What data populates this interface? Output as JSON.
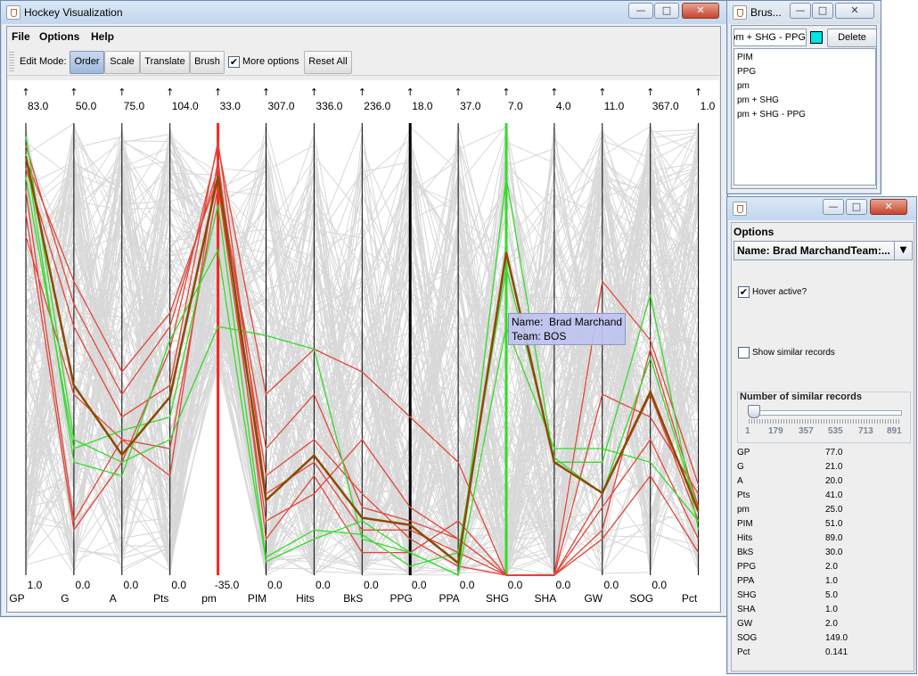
{
  "main_window": {
    "title": "Hockey Visualization",
    "menus": [
      "File",
      "Options",
      "Help"
    ],
    "toolbar": {
      "edit_mode_label": "Edit Mode:",
      "buttons": [
        "Order",
        "Scale",
        "Translate",
        "Brush"
      ],
      "active_button": "Order",
      "more_options_label": "More options",
      "more_options_checked": true,
      "reset_label": "Reset All"
    }
  },
  "chart_data": {
    "type": "parallel-coordinates",
    "axes": [
      {
        "name": "GP",
        "max": "83.0",
        "min": "1.0"
      },
      {
        "name": "G",
        "max": "50.0",
        "min": "0.0"
      },
      {
        "name": "A",
        "max": "75.0",
        "min": "0.0"
      },
      {
        "name": "Pts",
        "max": "104.0",
        "min": "0.0"
      },
      {
        "name": "pm",
        "max": "33.0",
        "min": "-35.0"
      },
      {
        "name": "PIM",
        "max": "307.0",
        "min": "0.0"
      },
      {
        "name": "Hits",
        "max": "336.0",
        "min": "0.0"
      },
      {
        "name": "BkS",
        "max": "236.0",
        "min": "0.0"
      },
      {
        "name": "PPG",
        "max": "18.0",
        "min": "0.0"
      },
      {
        "name": "PPA",
        "max": "37.0",
        "min": "0.0"
      },
      {
        "name": "SHG",
        "max": "7.0",
        "min": "0.0"
      },
      {
        "name": "SHA",
        "max": "4.0",
        "min": "0.0"
      },
      {
        "name": "GW",
        "max": "11.0",
        "min": "0.0"
      },
      {
        "name": "SOG",
        "max": "367.0",
        "min": "0.0"
      },
      {
        "name": "Pct",
        "max": "1.0",
        "min": ""
      }
    ],
    "highlight": {
      "name": "Brad Marchand",
      "values": [
        77.0,
        21.0,
        20.0,
        41.0,
        25.0,
        51.0,
        89.0,
        30.0,
        2.0,
        1.0,
        5.0,
        1.0,
        2.0,
        149.0,
        0.141
      ],
      "color": "#8b4a00"
    },
    "colors": {
      "background": "#d8d8d8",
      "red": "#e0463a",
      "green": "#37d92b",
      "axis": "#000000"
    },
    "tooltip": {
      "line1": "Name:  Brad Marchand",
      "line2": "Team: BOS"
    }
  },
  "brush_window": {
    "title": "Brus...",
    "input_value": "pm + SHG - PPG",
    "swatch_color": "#00e5e5",
    "delete_label": "Delete",
    "items": [
      "PIM",
      "PPG",
      "pm",
      "pm + SHG",
      "pm + SHG - PPG"
    ]
  },
  "options_window": {
    "heading": "Options",
    "dropdown_value": "Name:  Brad MarchandTeam:...",
    "hover_label": "Hover active?",
    "hover_checked": true,
    "similar_label": "Show similar records",
    "similar_checked": false,
    "slider_title": "Number of similar records",
    "slider_ticks": [
      "1",
      "179",
      "357",
      "535",
      "713",
      "891"
    ],
    "stats": [
      {
        "key": "GP",
        "value": "77.0"
      },
      {
        "key": "G",
        "value": "21.0"
      },
      {
        "key": "A",
        "value": "20.0"
      },
      {
        "key": "Pts",
        "value": "41.0"
      },
      {
        "key": "pm",
        "value": "25.0"
      },
      {
        "key": "PIM",
        "value": "51.0"
      },
      {
        "key": "Hits",
        "value": "89.0"
      },
      {
        "key": "BkS",
        "value": "30.0"
      },
      {
        "key": "PPG",
        "value": "2.0"
      },
      {
        "key": "PPA",
        "value": "1.0"
      },
      {
        "key": "SHG",
        "value": "5.0"
      },
      {
        "key": "SHA",
        "value": "1.0"
      },
      {
        "key": "GW",
        "value": "2.0"
      },
      {
        "key": "SOG",
        "value": "149.0"
      },
      {
        "key": "Pct",
        "value": "0.141"
      }
    ]
  }
}
